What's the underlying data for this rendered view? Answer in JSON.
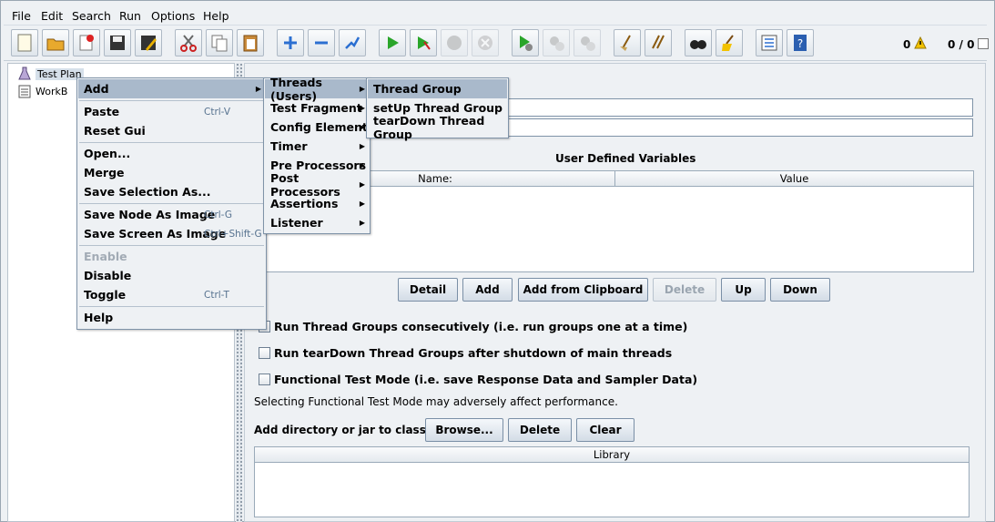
{
  "menubar": {
    "file": "File",
    "edit": "Edit",
    "search": "Search",
    "run": "Run",
    "options": "Options",
    "help": "Help"
  },
  "toolbar": {
    "counter_warnings": "0",
    "counter_threads": "0 / 0",
    "icons": [
      "new-icon",
      "open-icon",
      "close-icon",
      "save-icon",
      "save-as-icon",
      "cut-icon",
      "copy-icon",
      "paste-icon",
      "expand-icon",
      "collapse-icon",
      "toggle-icon",
      "start-icon",
      "start-no-pause-icon",
      "stop-icon",
      "shutdown-icon",
      "remote-start-icon",
      "remote-stop-icon",
      "remote-shutdown-icon",
      "clear-icon",
      "clear-all-icon",
      "search-icon",
      "reset-search-icon",
      "function-helper-icon",
      "help-icon"
    ]
  },
  "tree": {
    "items": [
      {
        "label": "Test Plan"
      },
      {
        "label": "WorkB"
      }
    ]
  },
  "context_menu": {
    "items": [
      {
        "label": "Add",
        "shortcut": ""
      },
      {
        "label": "Paste",
        "shortcut": "Ctrl-V"
      },
      {
        "label": "Reset Gui",
        "shortcut": ""
      },
      {
        "label": "Open...",
        "shortcut": ""
      },
      {
        "label": "Merge",
        "shortcut": ""
      },
      {
        "label": "Save Selection As...",
        "shortcut": ""
      },
      {
        "label": "Save Node As Image",
        "shortcut": "Ctrl-G"
      },
      {
        "label": "Save Screen As Image",
        "shortcut": "Ctrl+Shift-G"
      },
      {
        "label": "Enable",
        "shortcut": ""
      },
      {
        "label": "Disable",
        "shortcut": ""
      },
      {
        "label": "Toggle",
        "shortcut": "Ctrl-T"
      },
      {
        "label": "Help",
        "shortcut": ""
      }
    ]
  },
  "add_submenu": {
    "items": [
      {
        "label": "Threads (Users)"
      },
      {
        "label": "Test Fragment"
      },
      {
        "label": "Config Element"
      },
      {
        "label": "Timer"
      },
      {
        "label": "Pre Processors"
      },
      {
        "label": "Post Processors"
      },
      {
        "label": "Assertions"
      },
      {
        "label": "Listener"
      }
    ]
  },
  "threads_submenu": {
    "items": [
      {
        "label": "Thread Group"
      },
      {
        "label": "setUp Thread Group"
      },
      {
        "label": "tearDown Thread Group"
      }
    ]
  },
  "main": {
    "name_value": "",
    "comments_value": "",
    "udv_title": "User Defined Variables",
    "udv_columns": [
      "Name:",
      "Value"
    ],
    "buttons": {
      "detail": "Detail",
      "add": "Add",
      "add_from_clipboard": "Add from Clipboard",
      "delete": "Delete",
      "up": "Up",
      "down": "Down"
    },
    "checkboxes": [
      {
        "label": "Run Thread Groups consecutively (i.e. run groups one at a time)",
        "checked": false
      },
      {
        "label": "Run tearDown Thread Groups after shutdown of main threads",
        "checked": false
      },
      {
        "label": "Functional Test Mode (i.e. save Response Data and Sampler Data)",
        "checked": false
      }
    ],
    "functional_note": "Selecting Functional Test Mode may adversely affect performance.",
    "classpath_label": "Add directory or jar to classpath",
    "classpath_buttons": {
      "browse": "Browse...",
      "delete": "Delete",
      "clear": "Clear"
    },
    "library_column": "Library"
  }
}
